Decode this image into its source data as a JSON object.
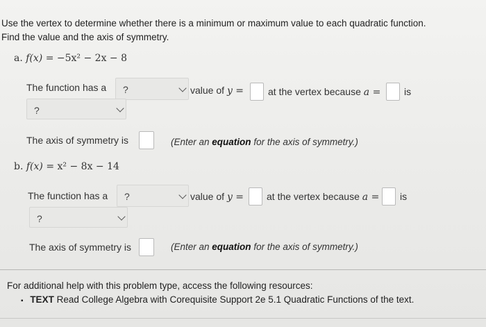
{
  "instructions": {
    "line1": "Use the vertex to determine whether there is a minimum or maximum value to each quadratic function.",
    "line2": "Find the value and the axis of symmetry."
  },
  "part_a": {
    "label": "a.",
    "function_lhs": "f(x)",
    "function_rhs": "= −5x² − 2x − 8",
    "text_function_has_a": "The function has a",
    "dropdown_placeholder": "?",
    "text_value_of": "value of",
    "var_y": "y =",
    "text_at_vertex": "at the vertex because",
    "var_a": "a =",
    "text_is": "is",
    "second_dropdown_placeholder": "?",
    "text_axis": "The axis of symmetry is",
    "hint_prefix": "(Enter an",
    "hint_bold": "equation",
    "hint_suffix": "for the axis of symmetry.)"
  },
  "part_b": {
    "label": "b.",
    "function_lhs": "f(x)",
    "function_rhs": "= x² − 8x − 14",
    "text_function_has_a": "The function has a",
    "dropdown_placeholder": "?",
    "text_value_of": "value of",
    "var_y": "y =",
    "text_at_vertex": "at the vertex because",
    "var_a": "a =",
    "text_is": "is",
    "second_dropdown_placeholder": "?",
    "text_axis": "The axis of symmetry is",
    "hint_prefix": "(Enter an",
    "hint_bold": "equation",
    "hint_suffix": "for the axis of symmetry.)"
  },
  "help": {
    "text": "For additional help with this problem type, access the following resources:",
    "bullet": "▪",
    "resource_type": "TEXT",
    "resource_text": "Read College Algebra with Corequisite Support 2e 5.1 Quadratic Functions of the text."
  }
}
